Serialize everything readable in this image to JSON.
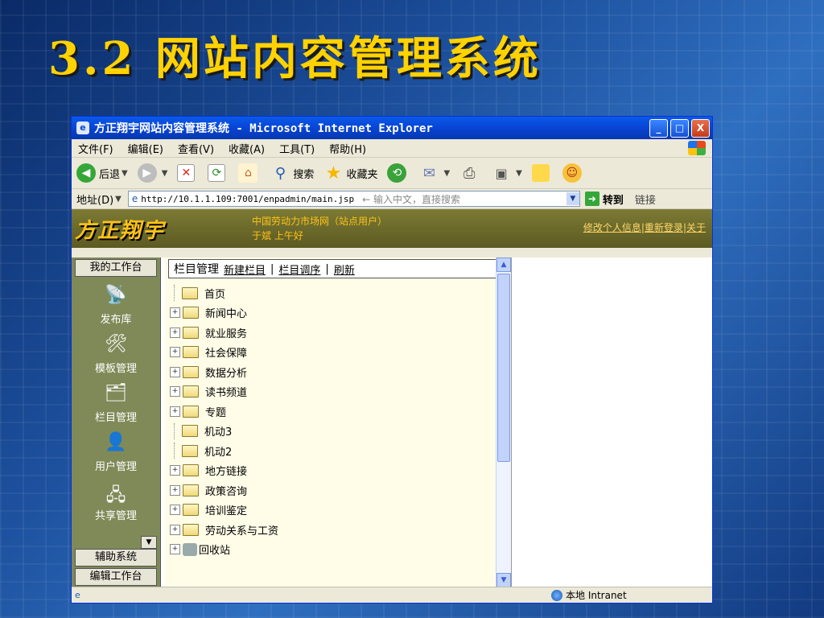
{
  "slide": {
    "title": "3.2 网站内容管理系统"
  },
  "window": {
    "title": "方正翔宇网站内容管理系统 - Microsoft Internet Explorer",
    "buttons": {
      "minimize": "_",
      "maximize": "□",
      "close": "X"
    }
  },
  "menu": [
    "文件(F)",
    "编辑(E)",
    "查看(V)",
    "收藏(A)",
    "工具(T)",
    "帮助(H)"
  ],
  "toolbar": {
    "back": "后退",
    "search": "搜索",
    "favorites": "收藏夹"
  },
  "address": {
    "label": "地址(D)",
    "url": "http://10.1.1.109:7001/enpadmin/main.jsp",
    "hint": "← 输入中文，直接搜索",
    "go": "转到",
    "links": "链接"
  },
  "banner": {
    "logo": "方正翔宇",
    "site": "中国劳动力市场网（站点用户）",
    "user": "于斌 上午好",
    "links": [
      "修改个人信息",
      "重新登录",
      "关于"
    ]
  },
  "leftnav": {
    "top_tab": "我的工作台",
    "items": [
      {
        "label": "发布库",
        "icon": "antenna-icon"
      },
      {
        "label": "模板管理",
        "icon": "tools-icon"
      },
      {
        "label": "栏目管理",
        "icon": "column-icon"
      },
      {
        "label": "用户管理",
        "icon": "user-icon"
      },
      {
        "label": "共享管理",
        "icon": "network-icon"
      }
    ],
    "bottom_tabs": [
      "辅助系统",
      "编辑工作台"
    ]
  },
  "tree": {
    "header": "栏目管理",
    "actions": [
      "新建栏目",
      "栏目调序",
      "刷新"
    ],
    "items": [
      {
        "label": "首页",
        "expandable": false
      },
      {
        "label": "新闻中心",
        "expandable": true
      },
      {
        "label": "就业服务",
        "expandable": true
      },
      {
        "label": "社会保障",
        "expandable": true
      },
      {
        "label": "数据分析",
        "expandable": true
      },
      {
        "label": "读书频道",
        "expandable": true
      },
      {
        "label": "专题",
        "expandable": true
      },
      {
        "label": "机动3",
        "expandable": false
      },
      {
        "label": "机动2",
        "expandable": false
      },
      {
        "label": "地方链接",
        "expandable": true
      },
      {
        "label": "政策咨询",
        "expandable": true
      },
      {
        "label": "培训鉴定",
        "expandable": true
      },
      {
        "label": "劳动关系与工资",
        "expandable": true
      },
      {
        "label": "回收站",
        "expandable": true
      }
    ]
  },
  "status": {
    "zone": "本地 Intranet"
  }
}
